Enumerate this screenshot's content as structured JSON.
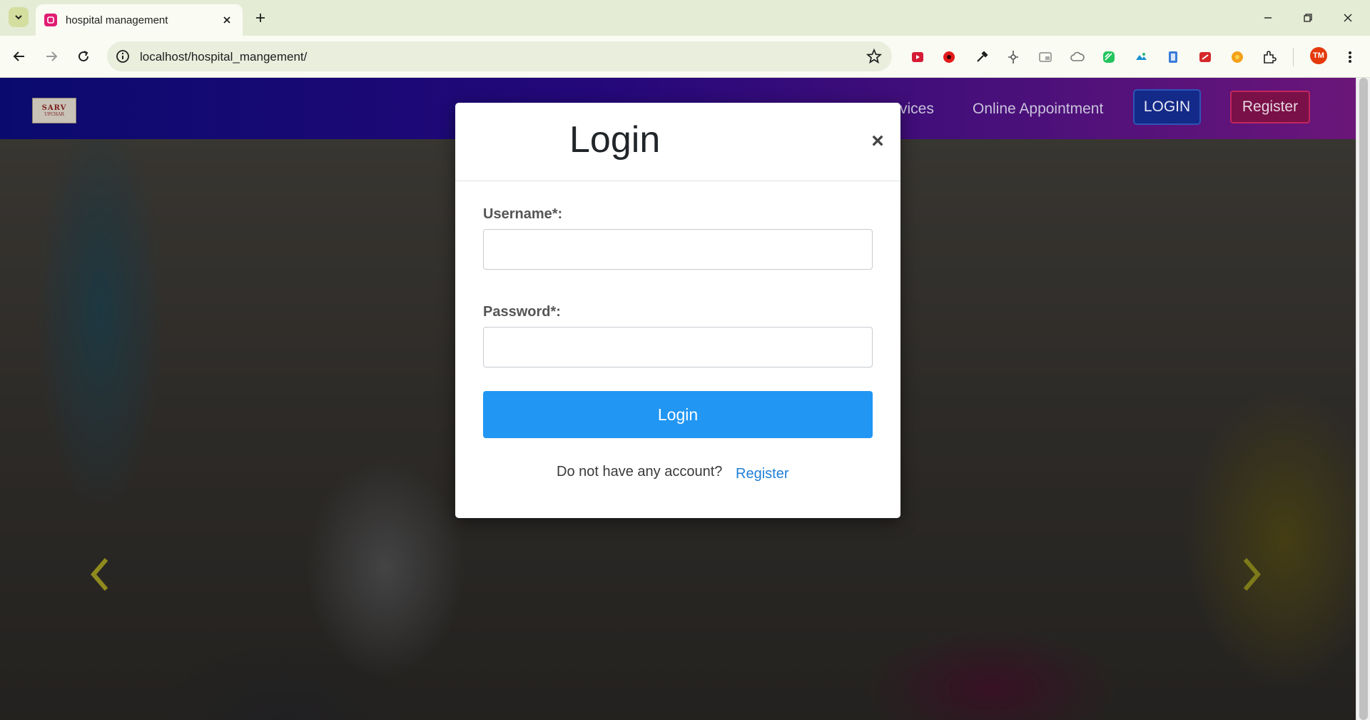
{
  "browser": {
    "tab_title": "hospital management",
    "url": "localhost/hospital_mangement/",
    "profile_initials": "TM"
  },
  "site": {
    "logo_line1": "SARV",
    "logo_line2": "UPCHAR",
    "nav_links": [
      "rvices",
      "Online Appointment"
    ],
    "login_button": "LOGIN",
    "register_button": "Register"
  },
  "modal": {
    "title": "Login",
    "close_symbol": "×",
    "username_label": "Username*:",
    "username_value": "",
    "password_label": "Password*:",
    "password_value": "",
    "submit_label": "Login",
    "footer_text": "Do not have any account?",
    "footer_link": "Register"
  },
  "colors": {
    "nav_gradient_start": "#0a0a6e",
    "nav_gradient_end": "#6b1679",
    "submit_button": "#2196f3",
    "link": "#1e7fd8",
    "nav_register_border": "#c1265e"
  }
}
